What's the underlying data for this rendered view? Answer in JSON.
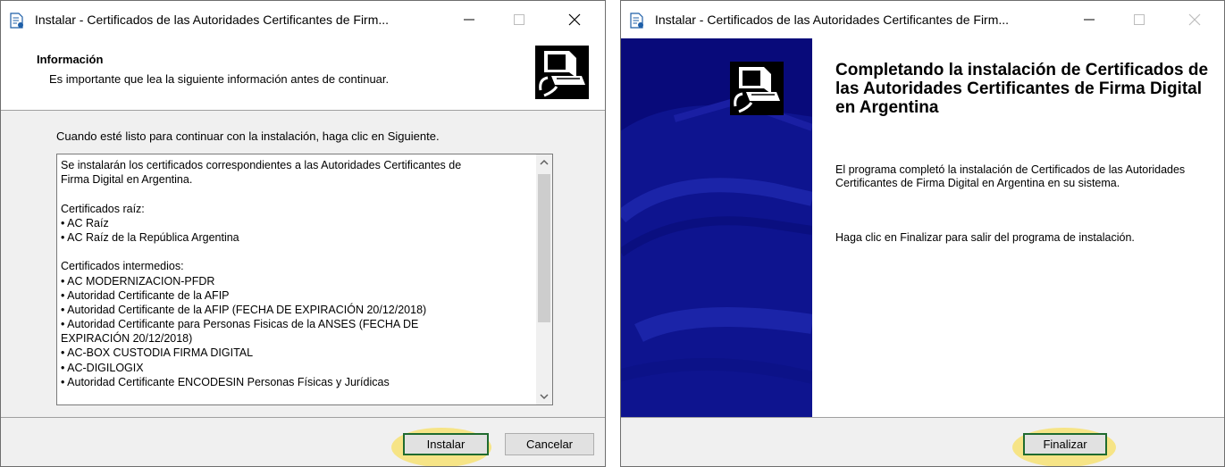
{
  "window_left": {
    "title": "Instalar - Certificados de las Autoridades Certificantes de Firm...",
    "header": {
      "title": "Información",
      "subtitle": "Es importante que lea la siguiente información antes de continuar."
    },
    "prompt": "Cuando esté listo para continuar con la instalación, haga clic en Siguiente.",
    "memo_lines": [
      "Se instalarán los certificados correspondientes a las Autoridades Certificantes de",
      "Firma Digital en Argentina.",
      "",
      "Certificados raíz:",
      "• AC Raíz",
      "• AC Raíz de la República Argentina",
      "",
      "Certificados intermedios:",
      "• AC MODERNIZACION-PFDR",
      "• Autoridad Certificante de la AFIP",
      "• Autoridad Certificante de la AFIP (FECHA DE EXPIRACIÓN 20/12/2018)",
      "• Autoridad Certificante para Personas Fisicas de la ANSES (FECHA DE",
      "EXPIRACIÓN 20/12/2018)",
      "• AC-BOX CUSTODIA FIRMA DIGITAL",
      "• AC-DIGILOGIX",
      "• Autoridad Certificante ENCODESIN Personas Físicas y Jurídicas"
    ],
    "buttons": {
      "install": "Instalar",
      "cancel": "Cancelar"
    }
  },
  "window_right": {
    "title": "Instalar - Certificados de las Autoridades Certificantes de Firm...",
    "heading": "Completando la instalación de Certificados de las Autoridades Certificantes de Firma Digital en Argentina",
    "paragraph1": "El programa completó la instalación de Certificados de las Autoridades Certificantes de Firma Digital en Argentina en su sistema.",
    "paragraph2": "Haga clic en Finalizar para salir del programa de instalación.",
    "buttons": {
      "finish": "Finalizar"
    }
  },
  "colors": {
    "highlight": "#f6e486",
    "default_button_border": "#1f6b2f",
    "wizard_panel": "#080a7a"
  },
  "icons": {
    "app": "installer-document-icon",
    "minimize": "minimize-icon",
    "maximize": "maximize-icon",
    "close": "close-icon",
    "logo": "computer-setup-icon"
  }
}
